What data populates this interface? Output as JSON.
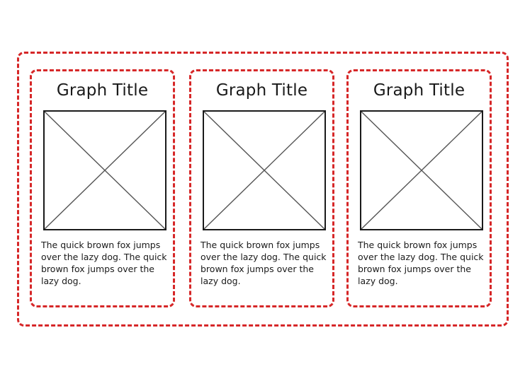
{
  "cards": [
    {
      "title": "Graph Title",
      "text": "The quick brown fox jumps over the lazy dog. The quick brown fox jumps over the lazy dog.",
      "image_icon": "image-placeholder-icon"
    },
    {
      "title": "Graph Title",
      "text": "The quick brown fox jumps over the lazy dog. The quick brown fox jumps over the lazy dog.",
      "image_icon": "image-placeholder-icon"
    },
    {
      "title": "Graph Title",
      "text": "The quick brown fox jumps over the lazy dog. The quick brown fox jumps over the lazy dog.",
      "image_icon": "image-placeholder-icon"
    }
  ],
  "colors": {
    "dashed_border": "#d62728",
    "text": "#1a1a1a",
    "placeholder_lines": "#555555"
  }
}
